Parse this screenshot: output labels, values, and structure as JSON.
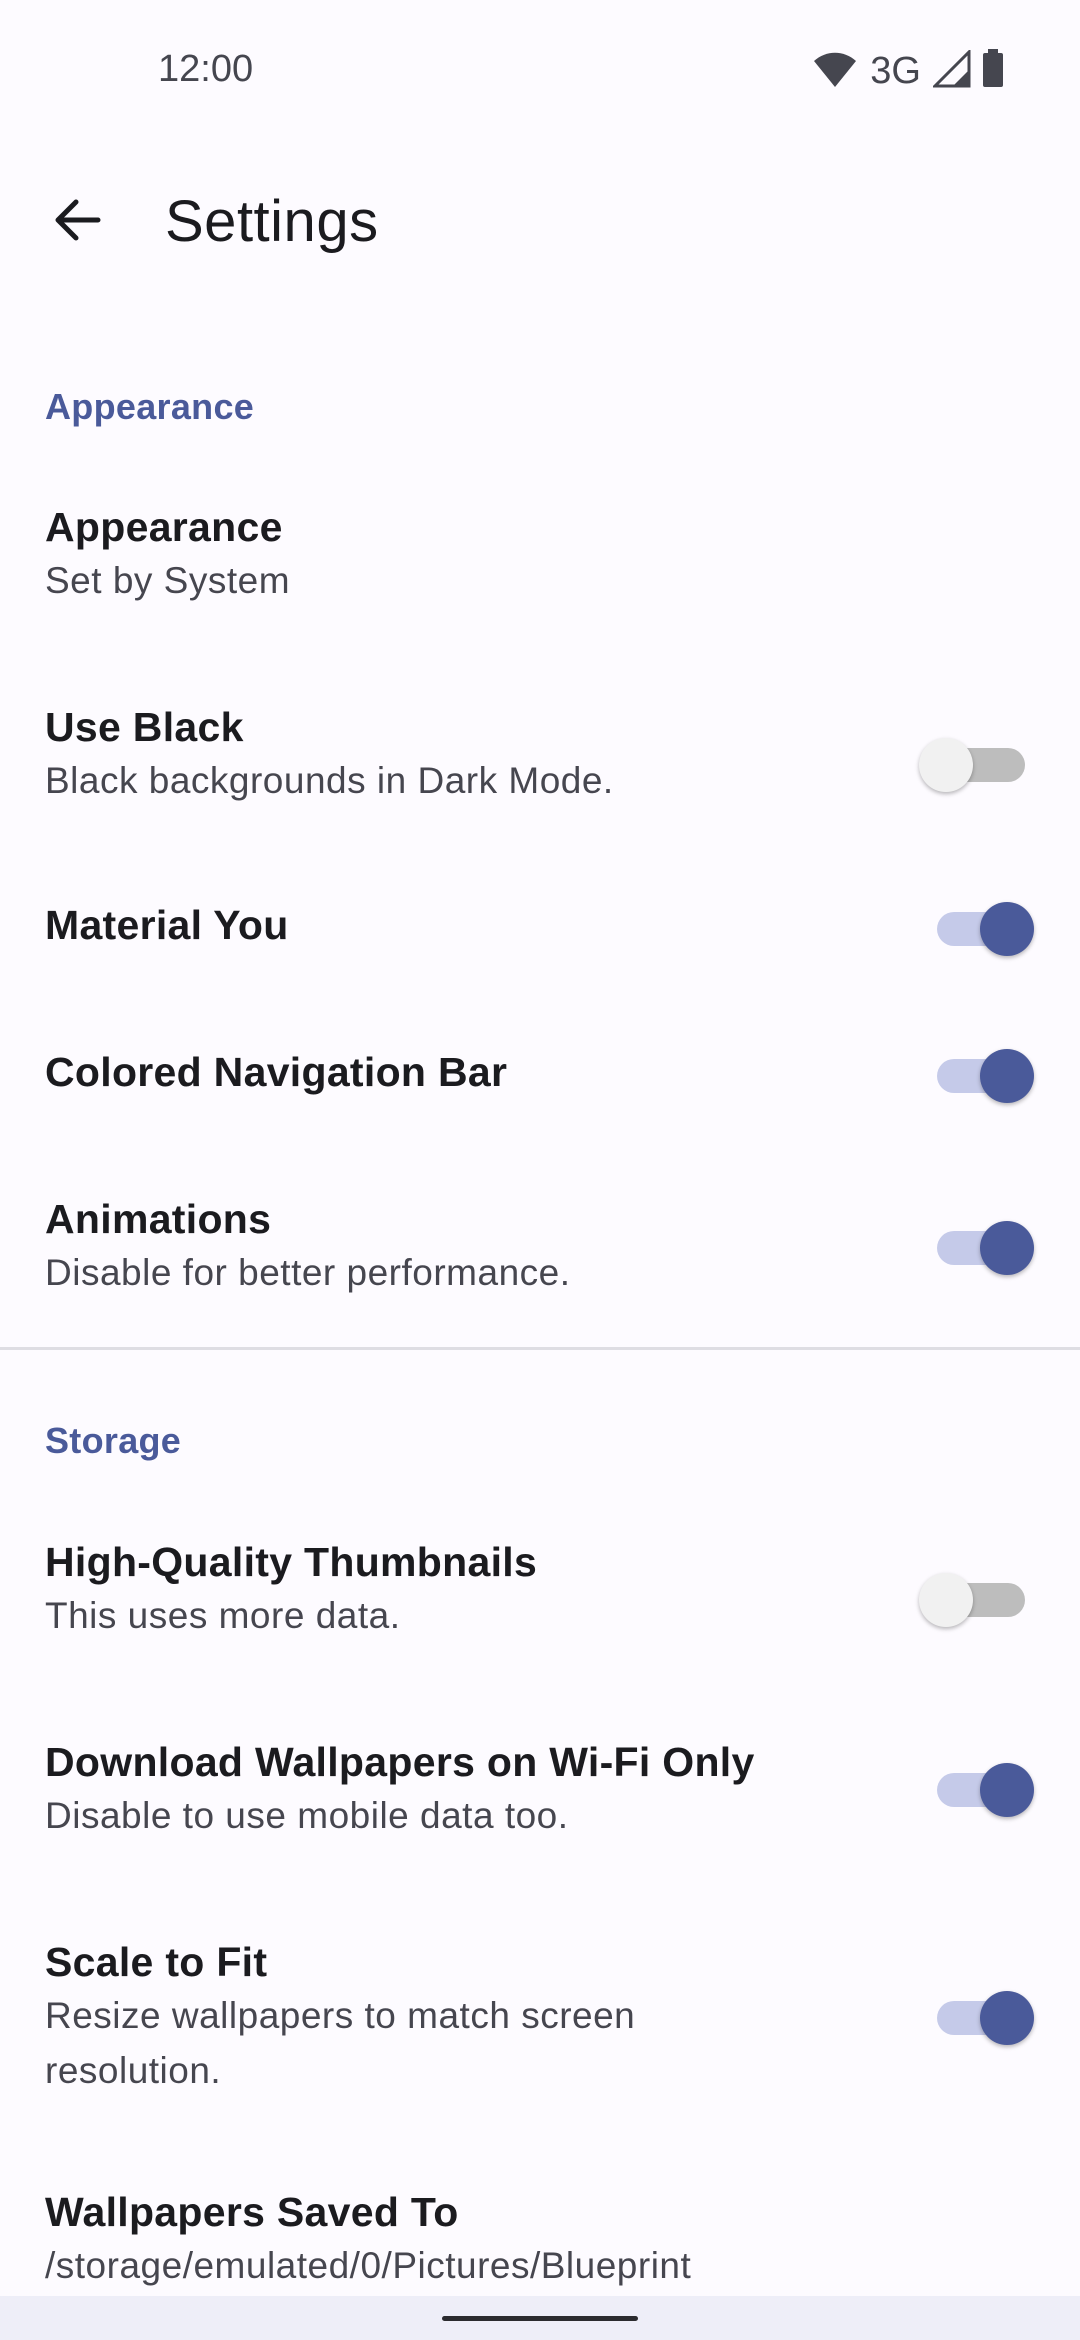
{
  "status_bar": {
    "time": "12:00",
    "network": "3G",
    "icons": [
      "wifi-icon",
      "cellular-signal-icon",
      "battery-icon"
    ]
  },
  "app_bar": {
    "back_icon": "arrow-back-icon",
    "title": "Settings"
  },
  "colors": {
    "accent": "#4a5a9a",
    "accent_track": "#c5cae9",
    "background": "#fdfbff",
    "switch_off_thumb": "#f1f1f1",
    "switch_off_track": "#bdbdbd"
  },
  "sections": [
    {
      "header": "Appearance",
      "items": [
        {
          "title": "Appearance",
          "summary": "Set by System",
          "switch": null
        },
        {
          "title": "Use Black",
          "summary": "Black backgrounds in Dark Mode.",
          "switch": false
        },
        {
          "title": "Material You",
          "summary": "",
          "switch": true
        },
        {
          "title": "Colored Navigation Bar",
          "summary": "",
          "switch": true
        },
        {
          "title": "Animations",
          "summary": "Disable for better performance.",
          "switch": true
        }
      ]
    },
    {
      "header": "Storage",
      "items": [
        {
          "title": "High-Quality Thumbnails",
          "summary": "This uses more data.",
          "switch": false
        },
        {
          "title": "Download Wallpapers on Wi-Fi Only",
          "summary": "Disable to use mobile data too.",
          "switch": true
        },
        {
          "title": "Scale to Fit",
          "summary": "Resize wallpapers to match screen resolution.",
          "switch": true
        },
        {
          "title": "Wallpapers Saved To",
          "summary": "/storage/emulated/0/Pictures/Blueprint",
          "switch": null
        }
      ]
    }
  ]
}
